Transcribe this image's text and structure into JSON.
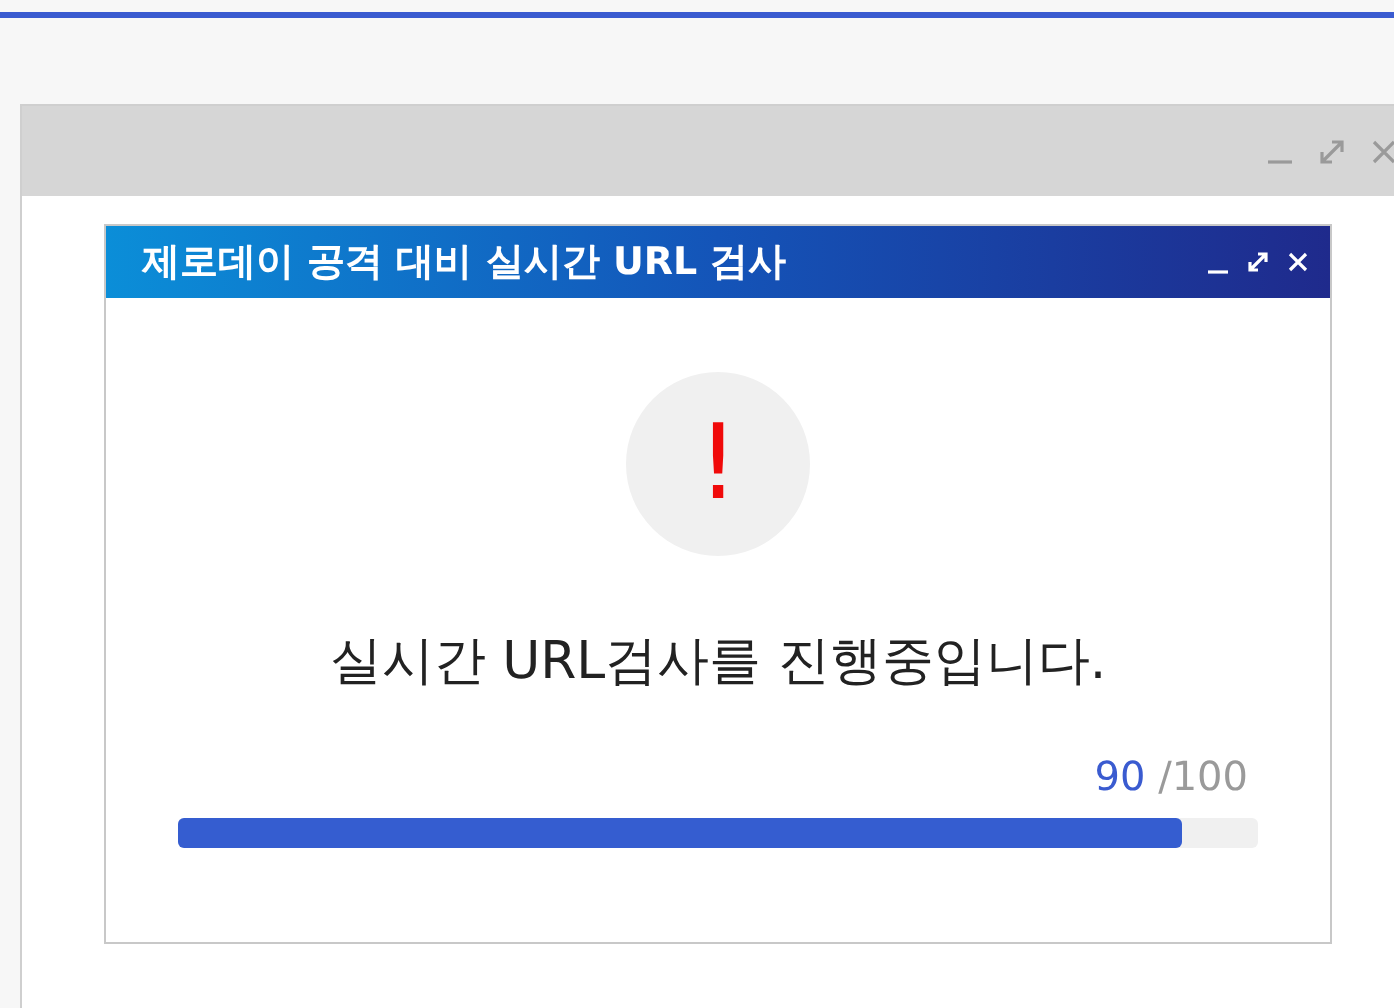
{
  "dialog": {
    "title": "제로데이 공격 대비 실시간 URL 검사",
    "alert_glyph": "!",
    "message": "실시간 URL검사를 진행중입니다.",
    "progress": {
      "current": "90",
      "total": "/100",
      "level": 0.93
    }
  }
}
